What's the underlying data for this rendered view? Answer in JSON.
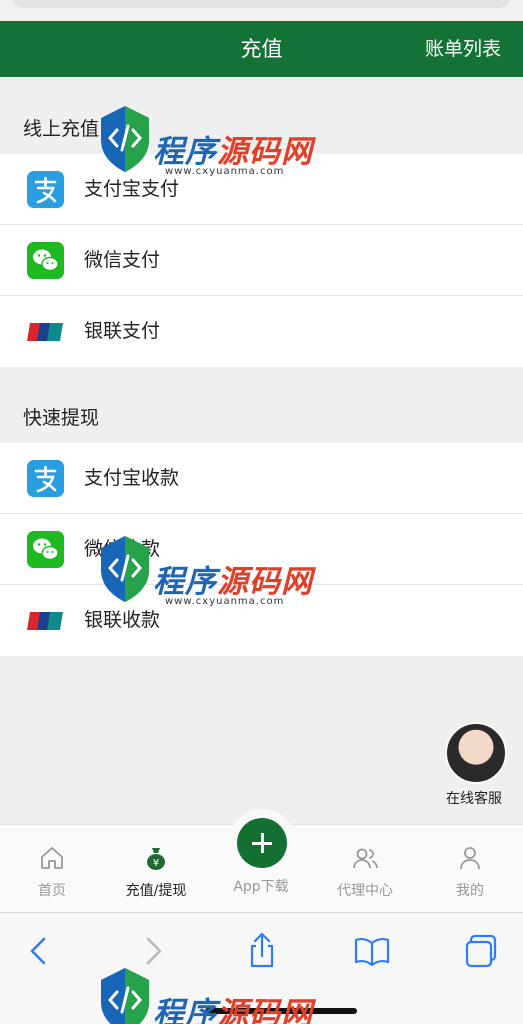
{
  "header": {
    "title": "充值",
    "bill_list": "账单列表"
  },
  "online_recharge": {
    "title": "线上充值",
    "items": [
      {
        "label": "支付宝支付",
        "icon": "alipay-icon"
      },
      {
        "label": "微信支付",
        "icon": "wechat-icon"
      },
      {
        "label": "银联支付",
        "icon": "unionpay-icon"
      }
    ]
  },
  "fast_withdraw": {
    "title": "快速提现",
    "items": [
      {
        "label": "支付宝收款",
        "icon": "alipay-icon"
      },
      {
        "label": "微信收款",
        "icon": "wechat-icon"
      },
      {
        "label": "银联收款",
        "icon": "unionpay-icon"
      }
    ]
  },
  "customer_service": {
    "label": "在线客服"
  },
  "tabbar": {
    "items": [
      {
        "label": "首页",
        "icon": "home-icon"
      },
      {
        "label": "充值/提现",
        "icon": "money-bag-icon"
      },
      {
        "label": "App下载",
        "icon": "plus-icon"
      },
      {
        "label": "代理中心",
        "icon": "users-icon"
      },
      {
        "label": "我的",
        "icon": "user-icon"
      }
    ]
  },
  "watermark": {
    "text_a": "程序",
    "text_b": "源码网",
    "url": "www.cxyuanma.com"
  },
  "colors": {
    "brand_green": "#147236",
    "alipay_blue": "#2a9ee0",
    "wechat_green": "#1fb922"
  }
}
